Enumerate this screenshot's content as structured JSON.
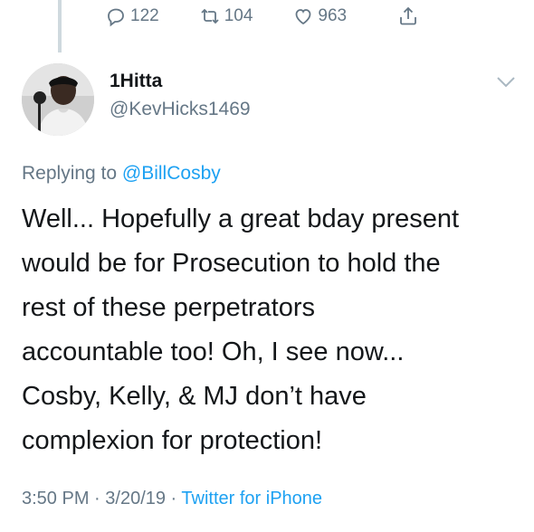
{
  "previous_tweet_actions": {
    "reply_count": "122",
    "retweet_count": "104",
    "like_count": "963",
    "icons": [
      "reply-icon",
      "retweet-icon",
      "like-icon",
      "share-icon"
    ]
  },
  "tweet": {
    "display_name": "1Hitta",
    "handle": "@KevHicks1469",
    "replying_prefix": "Replying to ",
    "replying_to": "@BillCosby",
    "text": "Well... Hopefully a great bday present\nwould be for Prosecution to hold the\nrest of these perpetrators\naccountable too! Oh, I see now...\nCosby, Kelly, & MJ don’t have\ncomplexion for protection!",
    "time": "3:50 PM",
    "separator": " · ",
    "date": "3/20/19",
    "source": "Twitter for iPhone"
  },
  "colors": {
    "link": "#1da1f2",
    "secondary_text": "#657786",
    "primary_text": "#14171a",
    "thread_line": "#cfd9de"
  }
}
